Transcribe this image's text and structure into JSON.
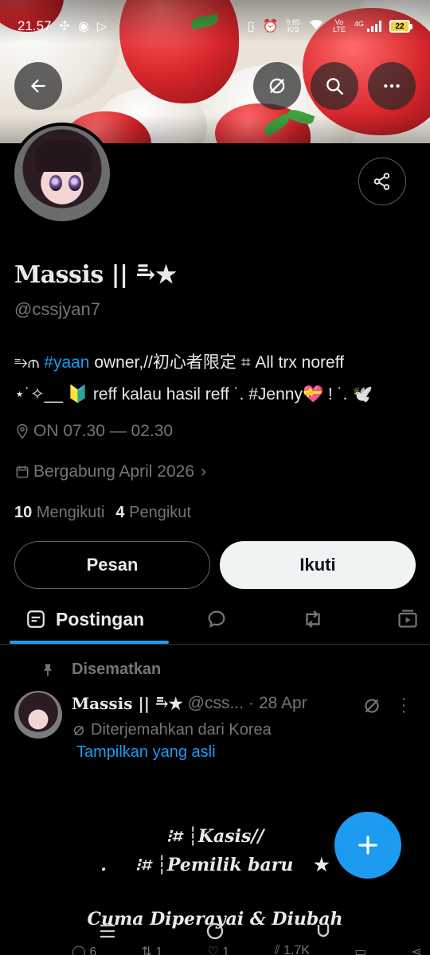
{
  "status_bar": {
    "time": "21.57",
    "net_speed_value": "9,85",
    "net_speed_unit": "K/S",
    "volte": "Vo LTE",
    "network": "4G",
    "battery": "22"
  },
  "header": {
    "back_icon": "arrow-left-icon",
    "translate_icon": "translate-icon",
    "search_icon": "search-icon",
    "more_icon": "more-horizontal-icon",
    "share_icon": "share-icon"
  },
  "profile": {
    "name": "Massis || ⥱★",
    "handle": "@cssjyan7",
    "bio_prefix": "⥱⫙",
    "bio_tag": "#yaan",
    "bio_rest": " owner,//初心者限定 ⌗ All trx noreff",
    "bio_line2": "⋆˙✧__ 🔰 reff kalau hasil reff ˙. #Jenny💝 ! ˙. 🕊️",
    "location": "ON 07.30 — 02.30",
    "joined": "Bergabung April 2026",
    "following_count": "10",
    "following_label": "Mengikuti",
    "followers_count": "4",
    "followers_label": "Pengikut",
    "message_button": "Pesan",
    "follow_button": "Ikuti"
  },
  "tabs": {
    "posts_label": "Postingan",
    "replies_icon": "reply-bubble-icon",
    "reposts_icon": "repost-icon",
    "media_icon": "media-icon"
  },
  "post": {
    "pinned_label": "Disematkan",
    "author_name": "Massis || ⥱★",
    "author_handle": "@css...",
    "separator": "·",
    "date": "28 Apr",
    "translated_note": "Diterjemahkan dari Korea",
    "show_original": "Tampilkan yang asli",
    "line1": "⁝⌗ ┆Kasis//",
    "line2_dot": ".",
    "line2": "⁝⌗ ┆Pemilik baru",
    "line2_star": "★",
    "line3": "Cuma Diperayai & Diubah",
    "reply_count": "6",
    "repost_count": "1",
    "like_count": "1",
    "view_count": "1,7K"
  },
  "colors": {
    "accent": "#1d9bf0",
    "muted": "#71767b",
    "background": "#000000",
    "text": "#e7e9ea"
  }
}
